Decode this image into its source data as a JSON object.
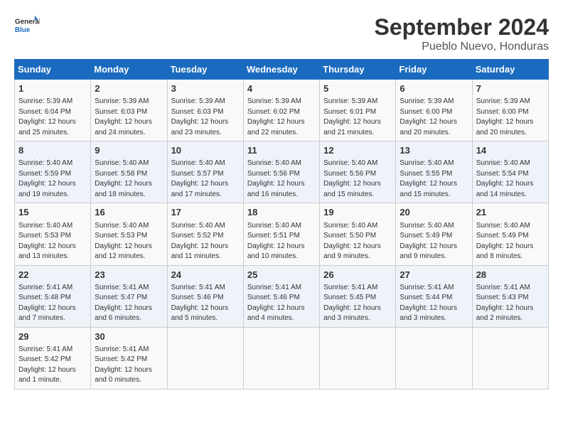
{
  "header": {
    "logo_line1": "General",
    "logo_line2": "Blue",
    "month": "September 2024",
    "location": "Pueblo Nuevo, Honduras"
  },
  "weekdays": [
    "Sunday",
    "Monday",
    "Tuesday",
    "Wednesday",
    "Thursday",
    "Friday",
    "Saturday"
  ],
  "weeks": [
    [
      {
        "day": "1",
        "info": "Sunrise: 5:39 AM\nSunset: 6:04 PM\nDaylight: 12 hours\nand 25 minutes."
      },
      {
        "day": "2",
        "info": "Sunrise: 5:39 AM\nSunset: 6:03 PM\nDaylight: 12 hours\nand 24 minutes."
      },
      {
        "day": "3",
        "info": "Sunrise: 5:39 AM\nSunset: 6:03 PM\nDaylight: 12 hours\nand 23 minutes."
      },
      {
        "day": "4",
        "info": "Sunrise: 5:39 AM\nSunset: 6:02 PM\nDaylight: 12 hours\nand 22 minutes."
      },
      {
        "day": "5",
        "info": "Sunrise: 5:39 AM\nSunset: 6:01 PM\nDaylight: 12 hours\nand 21 minutes."
      },
      {
        "day": "6",
        "info": "Sunrise: 5:39 AM\nSunset: 6:00 PM\nDaylight: 12 hours\nand 20 minutes."
      },
      {
        "day": "7",
        "info": "Sunrise: 5:39 AM\nSunset: 6:00 PM\nDaylight: 12 hours\nand 20 minutes."
      }
    ],
    [
      {
        "day": "8",
        "info": "Sunrise: 5:40 AM\nSunset: 5:59 PM\nDaylight: 12 hours\nand 19 minutes."
      },
      {
        "day": "9",
        "info": "Sunrise: 5:40 AM\nSunset: 5:58 PM\nDaylight: 12 hours\nand 18 minutes."
      },
      {
        "day": "10",
        "info": "Sunrise: 5:40 AM\nSunset: 5:57 PM\nDaylight: 12 hours\nand 17 minutes."
      },
      {
        "day": "11",
        "info": "Sunrise: 5:40 AM\nSunset: 5:56 PM\nDaylight: 12 hours\nand 16 minutes."
      },
      {
        "day": "12",
        "info": "Sunrise: 5:40 AM\nSunset: 5:56 PM\nDaylight: 12 hours\nand 15 minutes."
      },
      {
        "day": "13",
        "info": "Sunrise: 5:40 AM\nSunset: 5:55 PM\nDaylight: 12 hours\nand 15 minutes."
      },
      {
        "day": "14",
        "info": "Sunrise: 5:40 AM\nSunset: 5:54 PM\nDaylight: 12 hours\nand 14 minutes."
      }
    ],
    [
      {
        "day": "15",
        "info": "Sunrise: 5:40 AM\nSunset: 5:53 PM\nDaylight: 12 hours\nand 13 minutes."
      },
      {
        "day": "16",
        "info": "Sunrise: 5:40 AM\nSunset: 5:53 PM\nDaylight: 12 hours\nand 12 minutes."
      },
      {
        "day": "17",
        "info": "Sunrise: 5:40 AM\nSunset: 5:52 PM\nDaylight: 12 hours\nand 11 minutes."
      },
      {
        "day": "18",
        "info": "Sunrise: 5:40 AM\nSunset: 5:51 PM\nDaylight: 12 hours\nand 10 minutes."
      },
      {
        "day": "19",
        "info": "Sunrise: 5:40 AM\nSunset: 5:50 PM\nDaylight: 12 hours\nand 9 minutes."
      },
      {
        "day": "20",
        "info": "Sunrise: 5:40 AM\nSunset: 5:49 PM\nDaylight: 12 hours\nand 9 minutes."
      },
      {
        "day": "21",
        "info": "Sunrise: 5:40 AM\nSunset: 5:49 PM\nDaylight: 12 hours\nand 8 minutes."
      }
    ],
    [
      {
        "day": "22",
        "info": "Sunrise: 5:41 AM\nSunset: 5:48 PM\nDaylight: 12 hours\nand 7 minutes."
      },
      {
        "day": "23",
        "info": "Sunrise: 5:41 AM\nSunset: 5:47 PM\nDaylight: 12 hours\nand 6 minutes."
      },
      {
        "day": "24",
        "info": "Sunrise: 5:41 AM\nSunset: 5:46 PM\nDaylight: 12 hours\nand 5 minutes."
      },
      {
        "day": "25",
        "info": "Sunrise: 5:41 AM\nSunset: 5:46 PM\nDaylight: 12 hours\nand 4 minutes."
      },
      {
        "day": "26",
        "info": "Sunrise: 5:41 AM\nSunset: 5:45 PM\nDaylight: 12 hours\nand 3 minutes."
      },
      {
        "day": "27",
        "info": "Sunrise: 5:41 AM\nSunset: 5:44 PM\nDaylight: 12 hours\nand 3 minutes."
      },
      {
        "day": "28",
        "info": "Sunrise: 5:41 AM\nSunset: 5:43 PM\nDaylight: 12 hours\nand 2 minutes."
      }
    ],
    [
      {
        "day": "29",
        "info": "Sunrise: 5:41 AM\nSunset: 5:42 PM\nDaylight: 12 hours\nand 1 minute."
      },
      {
        "day": "30",
        "info": "Sunrise: 5:41 AM\nSunset: 5:42 PM\nDaylight: 12 hours\nand 0 minutes."
      },
      {
        "day": "",
        "info": ""
      },
      {
        "day": "",
        "info": ""
      },
      {
        "day": "",
        "info": ""
      },
      {
        "day": "",
        "info": ""
      },
      {
        "day": "",
        "info": ""
      }
    ]
  ]
}
